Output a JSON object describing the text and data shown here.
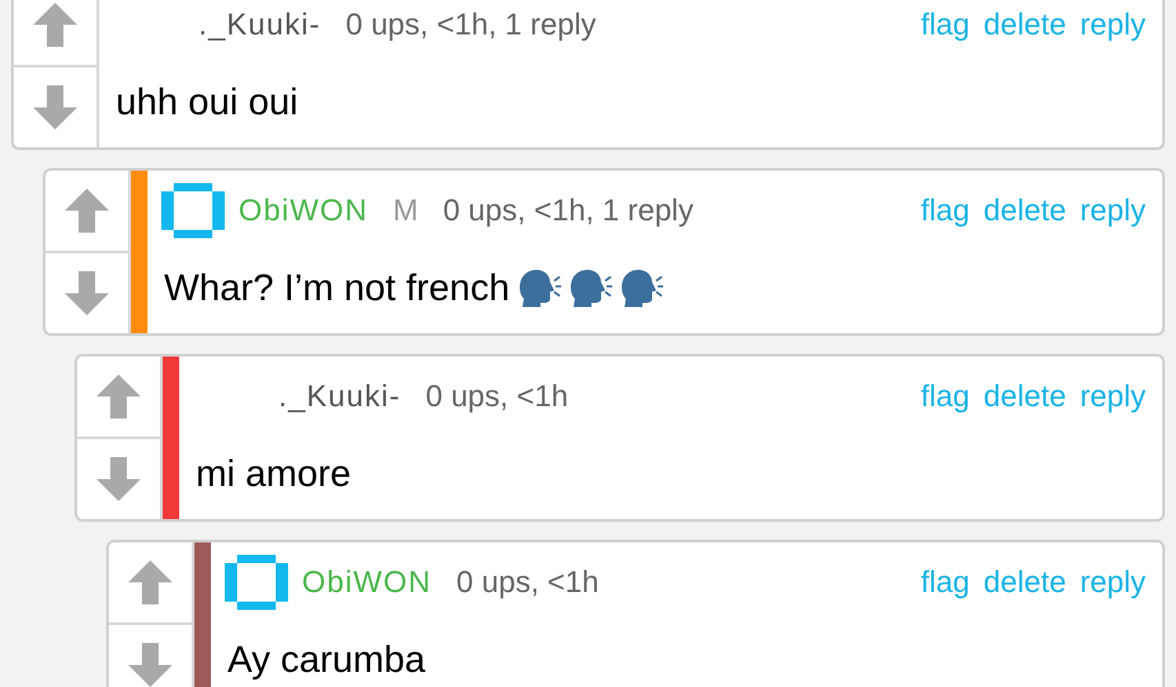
{
  "comments": [
    {
      "username": "._Kuuki-",
      "avatar": false,
      "meta": "0 ups, <1h, 1 reply",
      "actions": [
        "flag",
        "delete",
        "reply"
      ],
      "body": [
        {
          "kind": "text",
          "text": "uhh oui oui"
        }
      ]
    },
    {
      "username": "ObiWON",
      "avatar": true,
      "badge": "M",
      "color": "#ff8c0a",
      "meta": "0 ups, <1h, 1 reply",
      "actions": [
        "flag",
        "delete",
        "reply"
      ],
      "body": [
        {
          "kind": "text",
          "text": "Whar? I’m not french"
        },
        {
          "kind": "emoji"
        },
        {
          "kind": "emoji"
        },
        {
          "kind": "emoji"
        }
      ]
    },
    {
      "username": "._Kuuki-",
      "avatar": false,
      "color": "#f23a3a",
      "meta": "0 ups, <1h",
      "actions": [
        "flag",
        "delete",
        "reply"
      ],
      "body": [
        {
          "kind": "text",
          "text": "mi amore"
        }
      ]
    },
    {
      "username": "ObiWON",
      "avatar": true,
      "color": "#9e5a5a",
      "meta": "0 ups, <1h",
      "actions": [
        "flag",
        "delete",
        "reply"
      ],
      "body": [
        {
          "kind": "text",
          "text": "Ay carumba"
        }
      ]
    }
  ]
}
